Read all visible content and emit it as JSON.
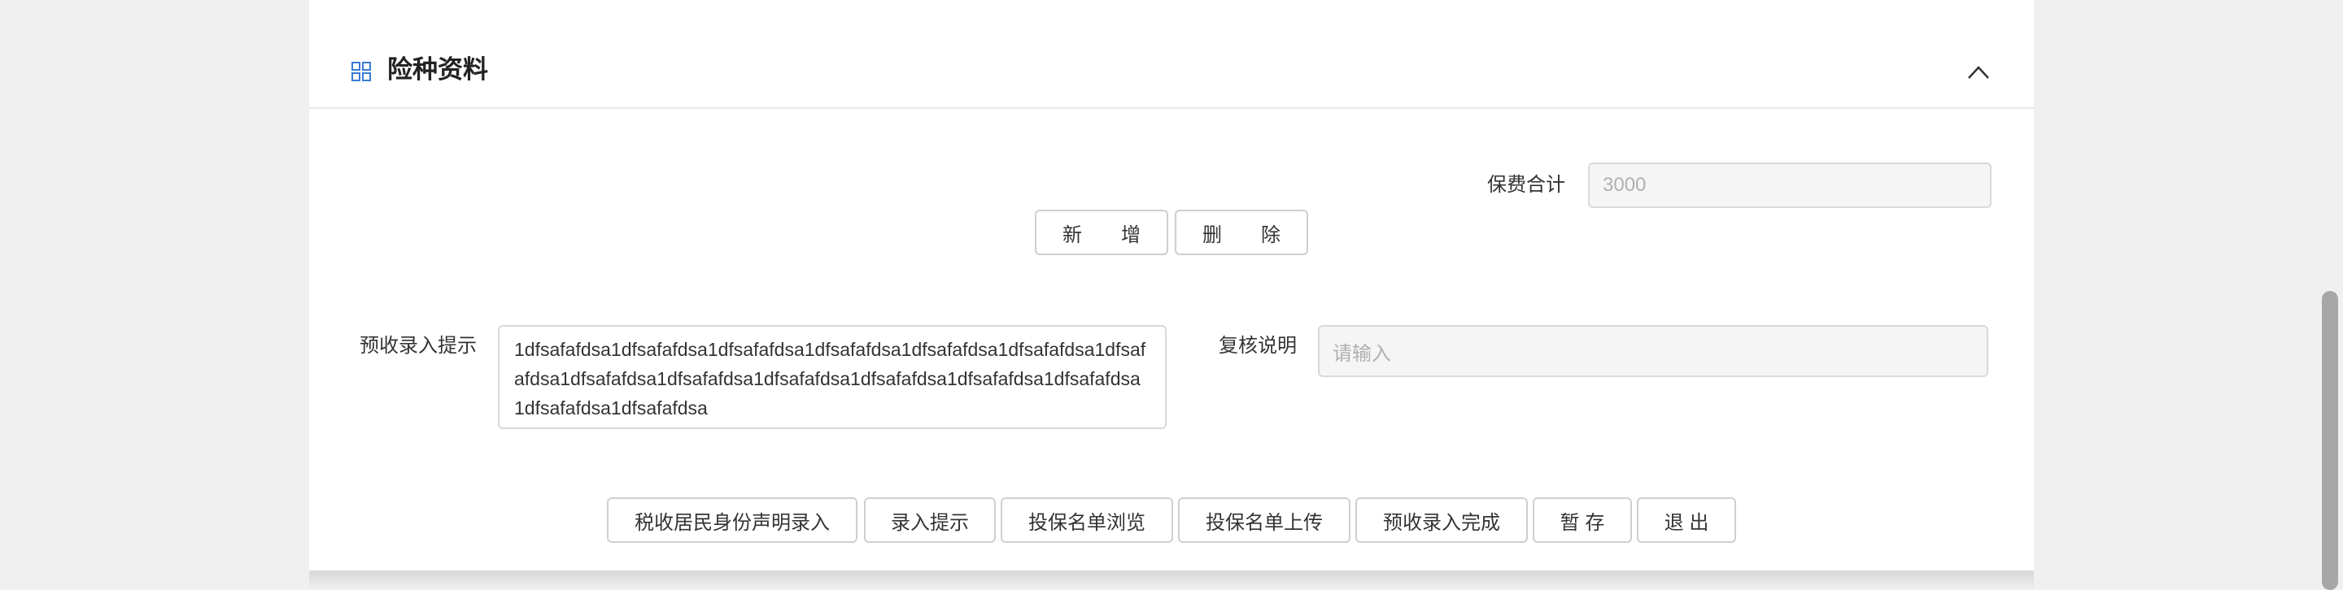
{
  "section": {
    "title": "险种资料",
    "header_icon": "grid-icon",
    "collapse_icon": "chevron-up-icon"
  },
  "premium": {
    "label": "保费合计",
    "value": "3000"
  },
  "row_actions": {
    "add_label": "新　　增",
    "delete_label": "删　　除"
  },
  "prompt": {
    "label": "预收录入提示",
    "value": "1dfsafafdsa1dfsafafdsa1dfsafafdsa1dfsafafdsa1dfsafafdsa1dfsafafdsa1dfsafafdsa1dfsafafdsa1dfsafafdsa1dfsafafdsa1dfsafafdsa1dfsafafdsa1dfsafafdsa1dfsafafdsa1dfsafafdsa"
  },
  "review": {
    "label": "复核说明",
    "placeholder": "请输入"
  },
  "footer_buttons": {
    "tax_label": "税收居民身份声明录入",
    "hint_label": "录入提示",
    "browse_label": "投保名单浏览",
    "upload_label": "投保名单上传",
    "complete_label": "预收录入完成",
    "save_label": "暂 存",
    "exit_label": "退 出"
  },
  "colors": {
    "accent": "#3a7bd5",
    "card": "#ffffff",
    "background": "#f0f0f0"
  }
}
